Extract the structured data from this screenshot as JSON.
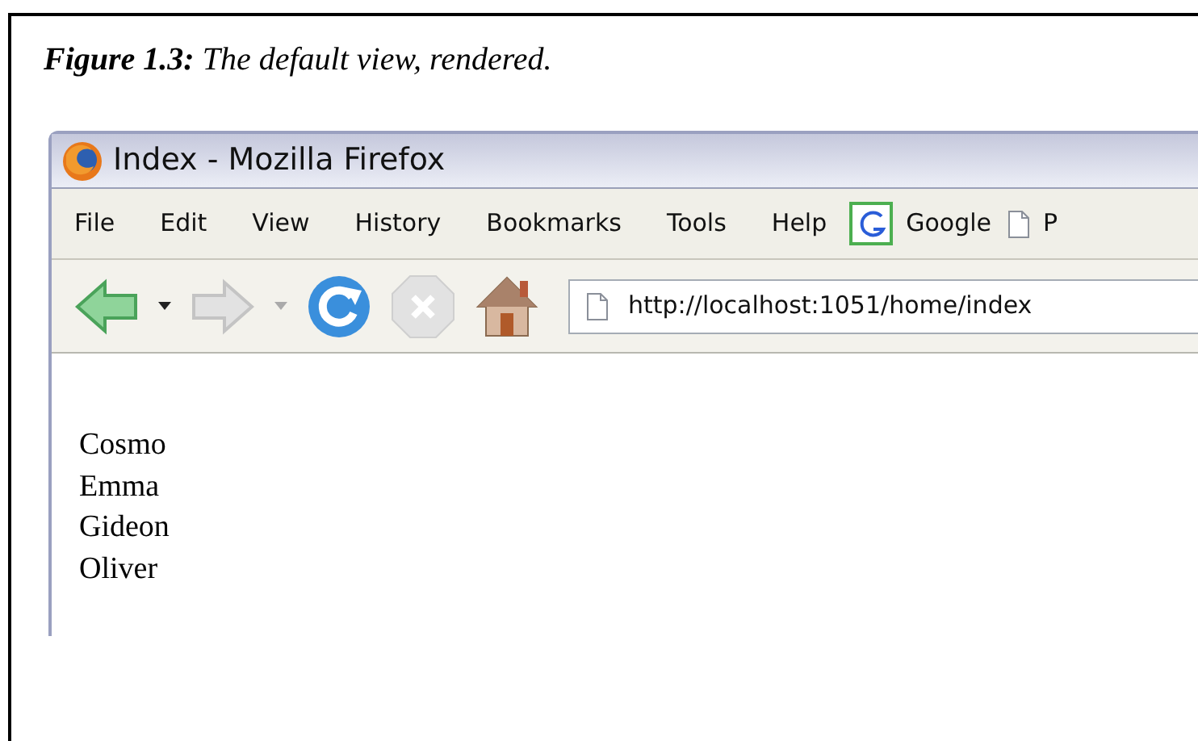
{
  "caption": "**Figure 1.3:** The default view, rendered.",
  "window": {
    "title": "Index - Mozilla Firefox"
  },
  "menu": [
    "File",
    "Edit",
    "View",
    "History",
    "Bookmarks",
    "Tools",
    "Help"
  ],
  "bookmarks": [
    {
      "kind": "google",
      "label": "Google"
    },
    {
      "kind": "page",
      "label": "P"
    }
  ],
  "address_bar": {
    "value": "http://localhost:1051/home/index"
  },
  "page_content": [
    "Cosmo",
    "Emma",
    "Gideon",
    "Oliver"
  ]
}
